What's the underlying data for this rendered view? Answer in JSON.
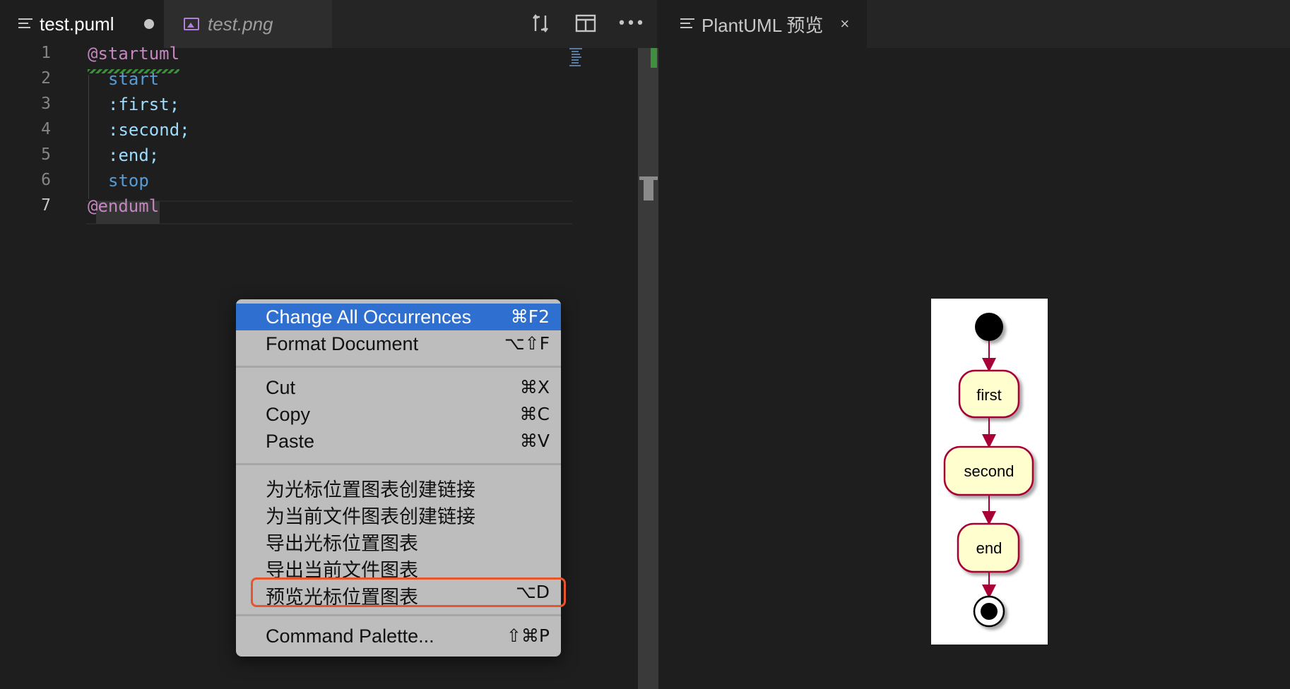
{
  "left_tabs": [
    {
      "label": "test.puml",
      "icon": "lines-icon",
      "dirty": true
    },
    {
      "label": "test.png",
      "icon": "image-icon"
    }
  ],
  "toolbar": {
    "icons": [
      "open-changes-icon",
      "split-editor-icon",
      "more-actions-icon"
    ],
    "more_label": "•••"
  },
  "right_tab": {
    "label": "PlantUML 预览",
    "close": "×",
    "icon": "lines-icon"
  },
  "editor": {
    "line_numbers": [
      "1",
      "2",
      "3",
      "4",
      "5",
      "6",
      "7"
    ],
    "lines": [
      "@startuml",
      "start",
      ":first;",
      ":second;",
      ":end;",
      "stop",
      "@enduml"
    ],
    "current_line": "7"
  },
  "context_menu": {
    "items": [
      {
        "label": "Change All Occurrences",
        "shortcut": "⌘F2",
        "selected": true
      },
      {
        "label": "Format Document",
        "shortcut": "⌥⇧F"
      },
      {
        "label": "Cut",
        "shortcut": "⌘X"
      },
      {
        "label": "Copy",
        "shortcut": "⌘C"
      },
      {
        "label": "Paste",
        "shortcut": "⌘V"
      },
      {
        "label": "为光标位置图表创建链接",
        "shortcut": ""
      },
      {
        "label": "为当前文件图表创建链接",
        "shortcut": ""
      },
      {
        "label": "导出光标位置图表",
        "shortcut": ""
      },
      {
        "label": "导出当前文件图表",
        "shortcut": ""
      },
      {
        "label": "预览光标位置图表",
        "shortcut": "⌥D",
        "highlighted": true
      },
      {
        "label": "Command Palette...",
        "shortcut": "⇧⌘P"
      }
    ]
  },
  "diagram": {
    "nodes": [
      "first",
      "second",
      "end"
    ],
    "colors": {
      "node_fill": "#fefece",
      "node_border": "#a80036",
      "arrow": "#a80036"
    }
  },
  "colors": {
    "menu_selected": "#2e6fd0",
    "highlight_box": "#e8552d"
  }
}
